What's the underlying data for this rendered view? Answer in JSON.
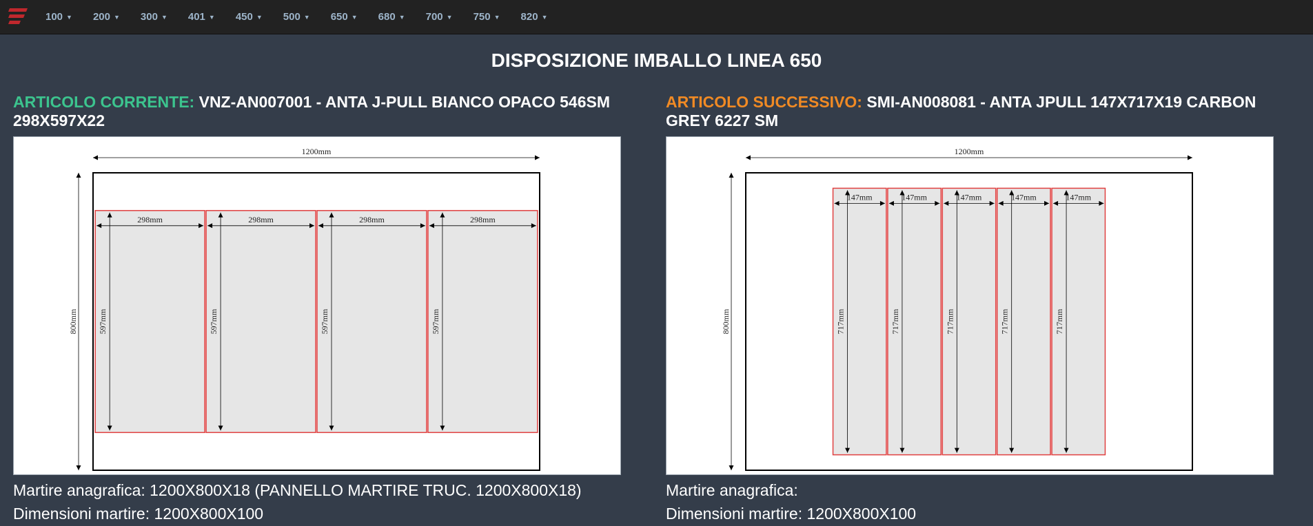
{
  "nav": {
    "logo_icon": "stacked-bars-logo-icon",
    "items": [
      "100",
      "200",
      "300",
      "401",
      "450",
      "500",
      "650",
      "680",
      "700",
      "750",
      "820"
    ]
  },
  "page_title": "DISPOSIZIONE IMBALLO LINEA 650",
  "current": {
    "label": "ARTICOLO CORRENTE:",
    "article": "VNZ-AN007001 - ANTA J-PULL BIANCO OPACO 546SM 298X597X22",
    "pallet_width_label": "1200mm",
    "pallet_height_label": "800mm",
    "piece_width_label": "298mm",
    "piece_height_label": "597mm",
    "piece_count": 4,
    "martire_anagrafica": "Martire anagrafica: 1200X800X18 (PANNELLO MARTIRE TRUC. 1200X800X18)",
    "dimensioni_martire": "Dimensioni martire: 1200X800X100"
  },
  "next": {
    "label": "ARTICOLO SUCCESSIVO:",
    "article": "SMI-AN008081 - ANTA JPULL 147X717X19 CARBON GREY 6227 SM",
    "pallet_width_label": "1200mm",
    "pallet_height_label": "800mm",
    "piece_width_label": "147mm",
    "piece_height_label": "717mm",
    "piece_count": 5,
    "martire_anagrafica": "Martire anagrafica:",
    "dimensioni_martire": "Dimensioni martire: 1200X800X100"
  },
  "colors": {
    "current_label": "#3cc48e",
    "next_label": "#f08a24",
    "piece_fill": "#e6e6e6",
    "piece_stroke": "#e04040"
  }
}
